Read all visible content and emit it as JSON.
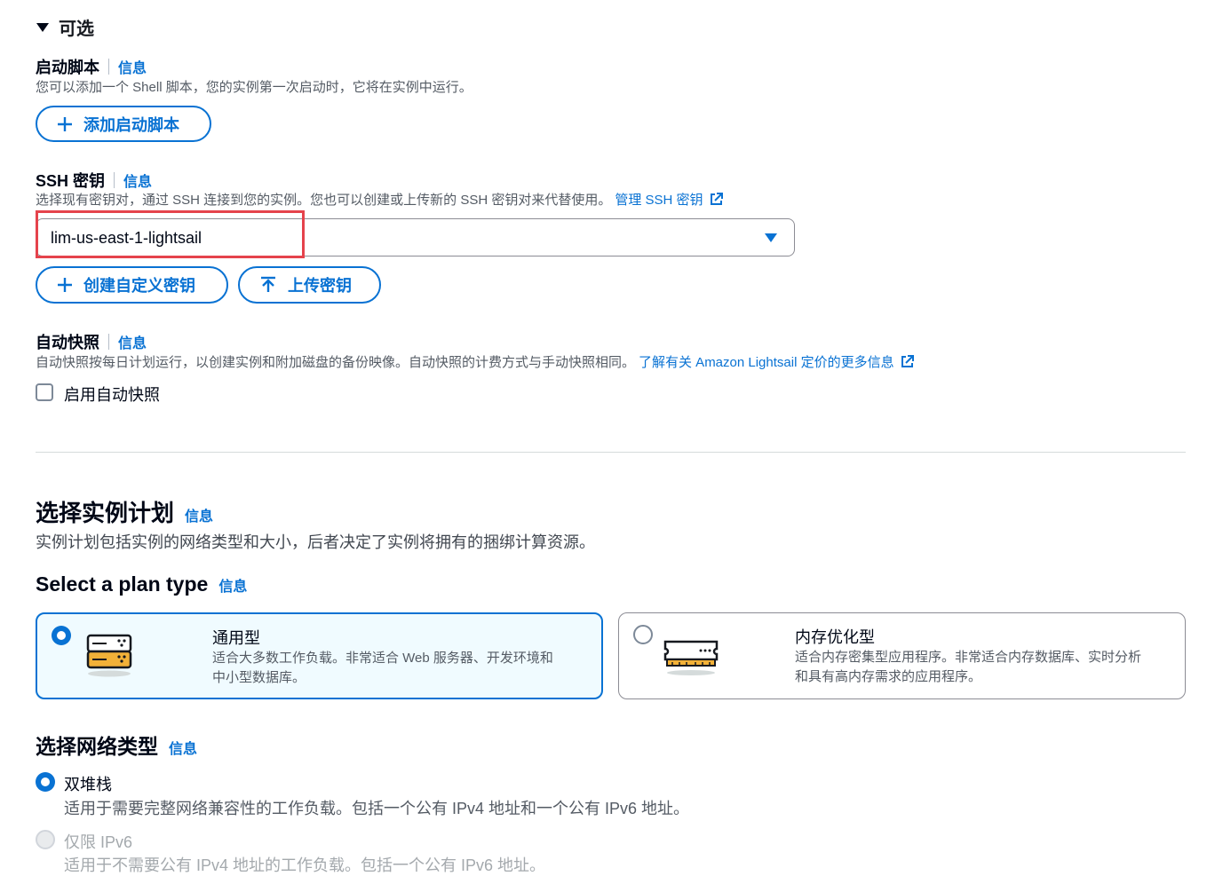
{
  "optional_section": {
    "title": "可选"
  },
  "launch_script": {
    "label": "启动脚本",
    "info": "信息",
    "description": "您可以添加一个 Shell 脚本，您的实例第一次启动时，它将在实例中运行。",
    "add_button": "添加启动脚本"
  },
  "ssh_key": {
    "label": "SSH 密钥",
    "info": "信息",
    "description": "选择现有密钥对，通过 SSH 连接到您的实例。您也可以创建或上传新的 SSH 密钥对来代替使用。",
    "manage_link": "管理 SSH 密钥",
    "selected_value": "lim-us-east-1-lightsail",
    "create_button": "创建自定义密钥",
    "upload_button": "上传密钥"
  },
  "auto_snapshot": {
    "label": "自动快照",
    "info": "信息",
    "description": "自动快照按每日计划运行，以创建实例和附加磁盘的备份映像。自动快照的计费方式与手动快照相同。",
    "pricing_link": "了解有关 Amazon Lightsail 定价的更多信息",
    "checkbox_label": "启用自动快照",
    "checked": false
  },
  "instance_plan": {
    "title": "选择实例计划",
    "info": "信息",
    "description": "实例计划包括实例的网络类型和大小，后者决定了实例将拥有的捆绑计算资源。"
  },
  "plan_type": {
    "title": "Select a plan type",
    "info": "信息",
    "options": [
      {
        "title": "通用型",
        "description_line1": "适合大多数工作负载。非常适合 Web 服务器、开发环境和",
        "description_line2": "中小型数据库。",
        "selected": true
      },
      {
        "title": "内存优化型",
        "description_line1": "适合内存密集型应用程序。非常适合内存数据库、实时分析",
        "description_line2": "和具有高内存需求的应用程序。",
        "selected": false
      }
    ]
  },
  "network_type": {
    "title": "选择网络类型",
    "info": "信息",
    "options": [
      {
        "label": "双堆栈",
        "description": "适用于需要完整网络兼容性的工作负载。包括一个公有 IPv4 地址和一个公有 IPv6 地址。",
        "selected": true,
        "disabled": false
      },
      {
        "label": "仅限 IPv6",
        "description": "适用于不需要公有 IPv4 地址的工作负载。包括一个公有 IPv6 地址。",
        "selected": false,
        "disabled": true
      }
    ]
  },
  "colors": {
    "accent": "#0972d3",
    "highlight": "#e5434c",
    "selected_card_bg": "#f0fbff"
  }
}
